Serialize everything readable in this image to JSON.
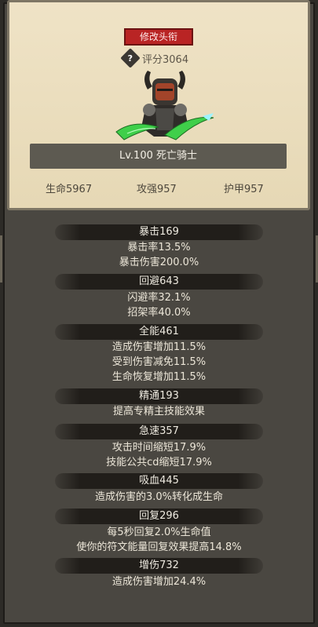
{
  "title_button": "修改头衔",
  "score": "评分3064",
  "character": {
    "level_name": "Lv.100 死亡骑士",
    "hp": "生命5967",
    "attack": "攻强957",
    "armor": "护甲957"
  },
  "stats": [
    {
      "header": "暴击169",
      "lines": [
        "暴击率13.5%",
        "暴击伤害200.0%"
      ]
    },
    {
      "header": "回避643",
      "lines": [
        "闪避率32.1%",
        "招架率40.0%"
      ]
    },
    {
      "header": "全能461",
      "lines": [
        "造成伤害增加11.5%",
        "受到伤害减免11.5%",
        "生命恢复增加11.5%"
      ]
    },
    {
      "header": "精通193",
      "lines": [
        "提高专精主技能效果"
      ]
    },
    {
      "header": "急速357",
      "lines": [
        "攻击时间缩短17.9%",
        "技能公共cd缩短17.9%"
      ]
    },
    {
      "header": "吸血445",
      "lines": [
        "造成伤害的3.0%转化成生命"
      ]
    },
    {
      "header": "回复296",
      "lines": [
        "每5秒回复2.0%生命值",
        "使你的符文能量回复效果提高14.8%"
      ]
    },
    {
      "header": "增伤732",
      "lines": [
        "造成伤害增加24.4%"
      ]
    }
  ],
  "icons": {
    "help": "question-diamond-icon",
    "hero": "death-knight-portrait"
  },
  "colors": {
    "button_red": "#b92424",
    "card_bg": "#efe3c6",
    "weapon_glow": "#3fcf4a"
  }
}
